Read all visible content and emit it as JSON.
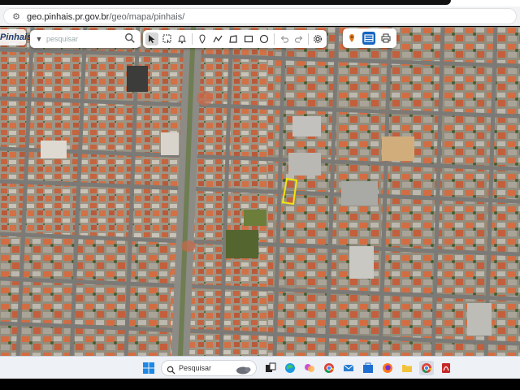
{
  "browser": {
    "url_host": "geo.pinhais.pr.gov.br",
    "url_path": "/geo/mapa/pinhais/",
    "site_icon": "tune-icon"
  },
  "app": {
    "logo_text": "Pinhais",
    "search_placeholder": "pesquisar",
    "tools": [
      "select-arrow-icon",
      "select-box-icon",
      "bell-icon",
      "pin-icon",
      "polyline-icon",
      "polygon-icon",
      "rectangle-icon",
      "circle-icon",
      "undo-icon",
      "redo-icon",
      "settings-icon"
    ],
    "layer_buttons": [
      "marker-layer-icon",
      "map-layer-icon",
      "print-icon"
    ]
  },
  "colors": {
    "highlight_parcel": "#f5e50a",
    "active_layer": "#1565c0"
  },
  "taskbar": {
    "search_label": "Pesquisar",
    "apps": [
      "file-explorer-icon",
      "edge-icon",
      "copilot-icon",
      "chrome-icon",
      "mail-icon",
      "store-icon",
      "firefox-icon",
      "folder-icon",
      "chrome-icon",
      "pdf-icon"
    ]
  }
}
